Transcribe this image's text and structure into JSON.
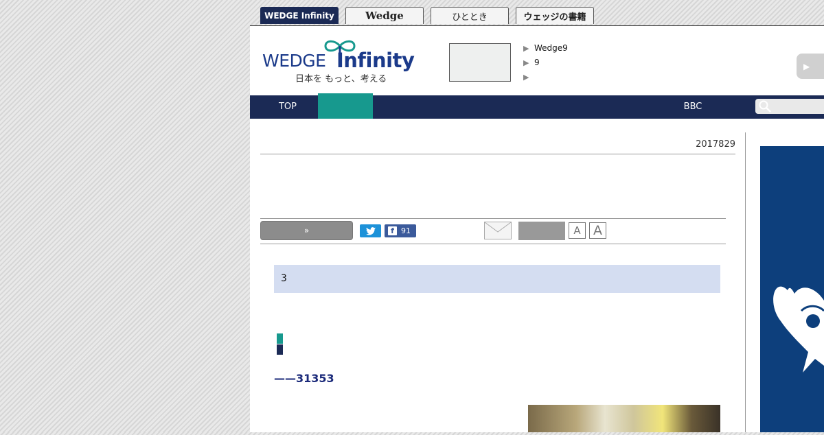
{
  "site_tabs": [
    {
      "label": "WEDGE Infinity",
      "active": true
    },
    {
      "label": "Wedge",
      "active": false
    },
    {
      "label": "ひととき",
      "active": false
    },
    {
      "label": "ウェッジの書籍",
      "active": false
    }
  ],
  "logo": {
    "wordmark_left": "WEDGE",
    "wordmark_right": "Infinity",
    "tagline": "日本を もっと、考える"
  },
  "header_news": [
    "Wedge9",
    "9",
    ""
  ],
  "nav": {
    "top": "TOP",
    "bbc": "BBC",
    "search_placeholder": ""
  },
  "article": {
    "date": "2017829",
    "share_button": "»",
    "facebook_count": "91",
    "font_small": "A",
    "font_large": "A",
    "lead": "3",
    "heading": "",
    "byline": "——31353"
  },
  "colors": {
    "navy": "#1b2a55",
    "teal": "#17998e",
    "lead_bg": "#d4ddf1",
    "twitter": "#1d92d9",
    "facebook": "#3b5a9b"
  }
}
